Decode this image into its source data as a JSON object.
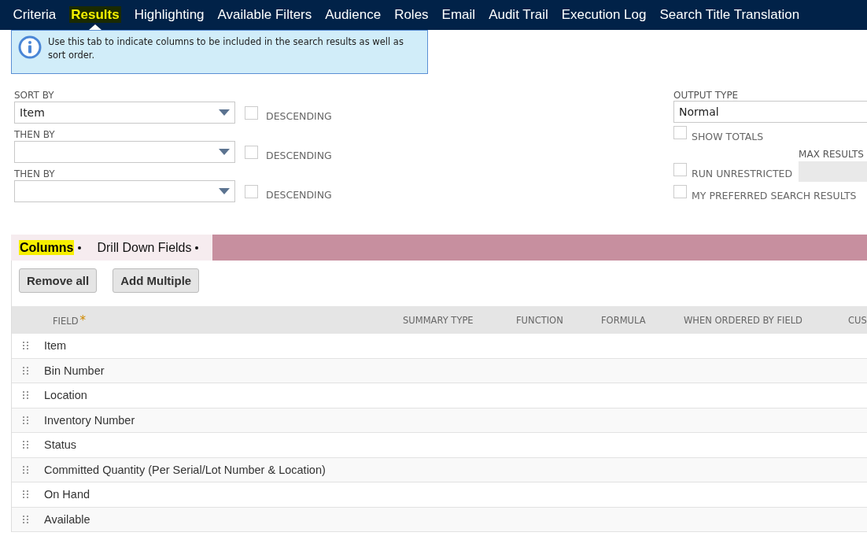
{
  "tabs": [
    {
      "label": "Criteria",
      "selected": false,
      "highlighted": false
    },
    {
      "label": "Results",
      "selected": true,
      "highlighted": true
    },
    {
      "label": "Highlighting",
      "selected": false,
      "highlighted": false
    },
    {
      "label": "Available Filters",
      "selected": false,
      "highlighted": false
    },
    {
      "label": "Audience",
      "selected": false,
      "highlighted": false
    },
    {
      "label": "Roles",
      "selected": false,
      "highlighted": false
    },
    {
      "label": "Email",
      "selected": false,
      "highlighted": false
    },
    {
      "label": "Audit Trail",
      "selected": false,
      "highlighted": false
    },
    {
      "label": "Execution Log",
      "selected": false,
      "highlighted": false
    },
    {
      "label": "Search Title Translation",
      "selected": false,
      "highlighted": false
    }
  ],
  "info_message": "Use this tab to indicate columns to be included in the search results as well as sort order.",
  "sort_fields": [
    {
      "label": "SORT BY",
      "value": "Item",
      "descending_label": "DESCENDING",
      "descending": false
    },
    {
      "label": "THEN BY",
      "descending_label": "DESCENDING",
      "descending": false
    },
    {
      "label": "THEN BY",
      "descending_label": "DESCENDING",
      "descending": false
    }
  ],
  "output_type": {
    "label": "OUTPUT TYPE",
    "value": "Normal"
  },
  "options": [
    {
      "label": "SHOW TOTALS",
      "checked": false
    },
    {
      "label": "RUN UNRESTRICTED",
      "checked": false
    },
    {
      "label": "MY PREFERRED SEARCH RESULTS",
      "checked": false
    }
  ],
  "max_results": {
    "label": "MAX RESULTS"
  },
  "subtabs": [
    {
      "label": "Columns",
      "selected": true,
      "highlighted": true
    },
    {
      "label": "Drill Down Fields",
      "selected": false,
      "highlighted": false
    }
  ],
  "buttons": [
    "Remove all",
    "Add Multiple"
  ],
  "table": {
    "columns": [
      {
        "label": "FIELD",
        "required": true
      },
      {
        "label": "SUMMARY TYPE",
        "required": false
      },
      {
        "label": "FUNCTION",
        "required": false
      },
      {
        "label": "FORMULA",
        "required": false
      },
      {
        "label": "WHEN ORDERED BY FIELD",
        "required": false
      },
      {
        "label": "CUS",
        "required": false
      }
    ],
    "required_mark": "*",
    "rows": [
      "Item",
      "Bin Number",
      "Location",
      "Inventory Number",
      "Status",
      "Committed Quantity (Per Serial/Lot Number & Location)",
      "On Hand",
      "Available"
    ]
  }
}
